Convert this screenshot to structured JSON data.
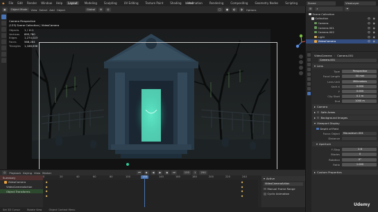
{
  "window": {
    "title": "blend",
    "watermark": "Udemy"
  },
  "menubar": {
    "menus": [
      "File",
      "Edit",
      "Render",
      "Window",
      "Help"
    ],
    "workspaces": [
      {
        "label": "Layout",
        "active": true
      },
      {
        "label": "Modeling",
        "active": false
      },
      {
        "label": "Sculpting",
        "active": false
      },
      {
        "label": "UV Editing",
        "active": false
      },
      {
        "label": "Texture Paint",
        "active": false
      },
      {
        "label": "Shading",
        "active": false
      },
      {
        "label": "Animation",
        "active": false
      },
      {
        "label": "Rendering",
        "active": false
      },
      {
        "label": "Compositing",
        "active": false
      },
      {
        "label": "Geometry Nodes",
        "active": false
      },
      {
        "label": "Scripting",
        "active": false
      }
    ],
    "scene": "Scene",
    "view_layer": "ViewLayer"
  },
  "viewport_header": {
    "mode": "Object Mode",
    "items": [
      "View",
      "Select",
      "Add",
      "Object"
    ],
    "orientation": "Global",
    "options": "Options"
  },
  "view_info": {
    "line1": "Camera Perspective",
    "line2": "(133) Scene Collection | VideoCamera",
    "stats": [
      {
        "label": "Objects",
        "value": "1 / 111"
      },
      {
        "label": "Vertices",
        "value": "895,780"
      },
      {
        "label": "Edges",
        "value": "1,274,023"
      },
      {
        "label": "Faces",
        "value": "588,284"
      },
      {
        "label": "Triangles",
        "value": "1,188,638"
      }
    ]
  },
  "outliner": {
    "title": "Scene Collection",
    "rows": [
      {
        "label": "Scene Collection",
        "selected": false
      },
      {
        "label": "Collection",
        "selected": false
      },
      {
        "label": "Camera",
        "selected": false
      },
      {
        "label": "Camera.001",
        "selected": false
      },
      {
        "label": "Camera.002",
        "selected": false
      },
      {
        "label": "Light",
        "selected": false
      },
      {
        "label": "VideoCamera",
        "selected": true
      }
    ]
  },
  "properties": {
    "object_name": "VideoCamera",
    "data_name": "Camera.001",
    "datablock": "Camera.001",
    "lens_section": "Lens",
    "lens": {
      "type": "Perspective",
      "focal_length": "50 mm",
      "lens_unit": "Millimeters",
      "shift_x": "0.000",
      "shift_y": "0.000",
      "clip_start": "0.1 m",
      "clip_end": "1000 m"
    },
    "labels": {
      "type": "Type",
      "focal_length": "Focal Length",
      "lens_unit": "Lens Unit",
      "shift_x": "Shift X",
      "shift_y": "Y",
      "clip_start": "Clip Start",
      "clip_end": "End"
    },
    "panels": [
      "Camera",
      "Safe Areas",
      "Background Images",
      "Viewport Display"
    ],
    "depth_of_field": "Depth of Field",
    "focus_object_label": "Focus Object",
    "focus_object": "Mausoleum.004",
    "focus_distance_label": "Distance",
    "aperture_section": "Aperture",
    "aperture": [
      {
        "label": "F-Stop",
        "value": "2.8"
      },
      {
        "label": "Blades",
        "value": "0"
      },
      {
        "label": "Rotation",
        "value": "0°"
      },
      {
        "label": "Ratio",
        "value": "1.000"
      }
    ],
    "custom_props": "Custom Properties"
  },
  "timeline": {
    "header": [
      "Playback",
      "Keying",
      "View",
      "Marker"
    ],
    "current_frame": "133",
    "ticks": [
      "0",
      "20",
      "40",
      "60",
      "80",
      "100",
      "120",
      "140",
      "160",
      "180",
      "200",
      "220",
      "240"
    ],
    "channels": [
      "Summary",
      "VideoCamera",
      "VideoCameraAction",
      "Object Transforms"
    ],
    "start": "1",
    "end": "250",
    "action_panel": {
      "title": "Active",
      "item1": "VideoCameraAction",
      "item2": "Manual Frame Range",
      "item3": "Cyclic Animation"
    }
  },
  "statusbar": {
    "items": [
      "Set 3D Cursor",
      "Rotate View",
      "Object Context Menu"
    ]
  }
}
